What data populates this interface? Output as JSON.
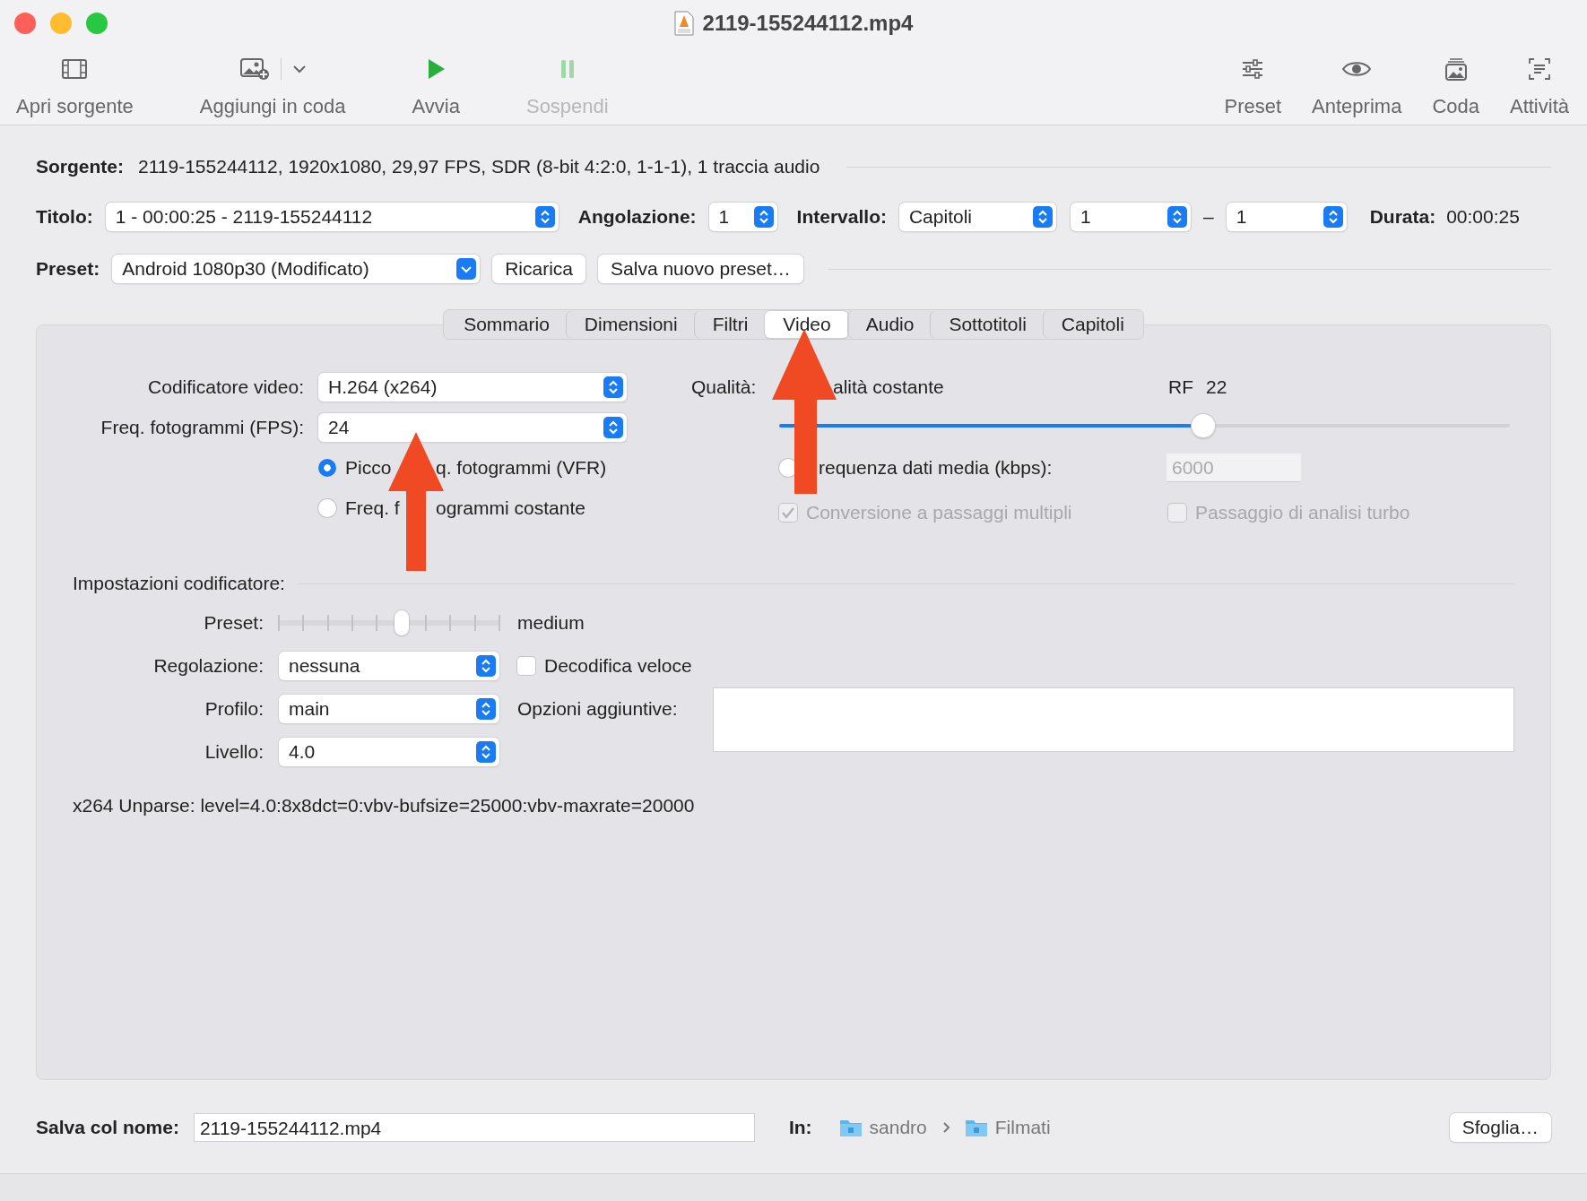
{
  "window": {
    "title": "2119-155244112.mp4"
  },
  "toolbar": {
    "left": [
      {
        "label": "Apri sorgente",
        "kind": "film",
        "menu": false,
        "disabled": false
      },
      {
        "label": "Aggiungi in coda",
        "kind": "add-image",
        "menu": true,
        "disabled": false
      },
      {
        "label": "Avvia",
        "kind": "play",
        "menu": false,
        "disabled": false
      },
      {
        "label": "Sospendi",
        "kind": "pause",
        "menu": false,
        "disabled": true
      }
    ],
    "right": [
      {
        "label": "Preset",
        "kind": "sliders",
        "menu": false,
        "disabled": false
      },
      {
        "label": "Anteprima",
        "kind": "eye",
        "menu": false,
        "disabled": false
      },
      {
        "label": "Coda",
        "kind": "stack",
        "menu": false,
        "disabled": false
      },
      {
        "label": "Attività",
        "kind": "log",
        "menu": false,
        "disabled": false
      }
    ]
  },
  "source": {
    "label": "Sorgente:",
    "value": "2119-155244112, 1920x1080, 29,97 FPS, SDR (8-bit 4:2:0, 1-1-1), 1 traccia audio"
  },
  "title_row": {
    "title_label": "Titolo:",
    "title_value": "1 - 00:00:25 - 2119-155244112",
    "angle_label": "Angolazione:",
    "angle_value": "1",
    "range_label": "Intervallo:",
    "range_type": "Capitoli",
    "range_from": "1",
    "range_sep": "–",
    "range_to": "1",
    "duration_label": "Durata:",
    "duration_value": "00:00:25"
  },
  "preset_row": {
    "label": "Preset:",
    "value": "Android 1080p30 (Modificato)",
    "buttons": [
      "Ricarica",
      "Salva nuovo preset…"
    ]
  },
  "tabs": [
    {
      "label": "Sommario",
      "selected": false
    },
    {
      "label": "Dimensioni",
      "selected": false
    },
    {
      "label": "Filtri",
      "selected": false
    },
    {
      "label": "Video",
      "selected": true
    },
    {
      "label": "Audio",
      "selected": false
    },
    {
      "label": "Sottotitoli",
      "selected": false
    },
    {
      "label": "Capitoli",
      "selected": false
    }
  ],
  "video": {
    "encoder_label": "Codificatore video:",
    "encoder_value": "H.264 (x264)",
    "fps_label": "Freq. fotogrammi (FPS):",
    "fps_value": "24",
    "fps_modes": [
      {
        "parts": [
          "Picco",
          "q. fotogrammi (VFR)"
        ],
        "selected": true
      },
      {
        "parts": [
          "Freq. f",
          "ogrammi costante"
        ],
        "selected": false
      }
    ],
    "quality_label": "Qualità:",
    "constant_quality": "alità costante",
    "rf_label": "RF",
    "rf_value": "22",
    "quality_slider": {
      "level": 0.58
    },
    "bitrate": {
      "text": "requenza dati media (kbps):",
      "selected": false,
      "value": "6000",
      "disabled": true
    },
    "multipass": {
      "label": "Conversione a passaggi multipli",
      "checked": true,
      "disabled": true
    },
    "turbo": {
      "label": "Passaggio di analisi turbo",
      "checked": false,
      "disabled": true
    }
  },
  "encoder": {
    "heading": "Impostazioni codificatore:",
    "preset_label": "Preset:",
    "preset_slider": {
      "level": 0.556
    },
    "preset_value": "medium",
    "tune_label": "Regolazione:",
    "tune_value": "nessuna",
    "fast_decode": {
      "label": "Decodifica veloce",
      "checked": false
    },
    "profile_label": "Profilo:",
    "profile_value": "main",
    "level_label": "Livello:",
    "level_value": "4.0",
    "extra_label": "Opzioni aggiuntive:",
    "unparse": "x264 Unparse: level=4.0:8x8dct=0:vbv-bufsize=25000:vbv-maxrate=20000"
  },
  "footer": {
    "save_label": "Salva col nome:",
    "save_value": "2119-155244112.mp4",
    "in_label": "In:",
    "path": [
      "sandro",
      "Filmati"
    ],
    "browse": "Sfoglia…"
  }
}
